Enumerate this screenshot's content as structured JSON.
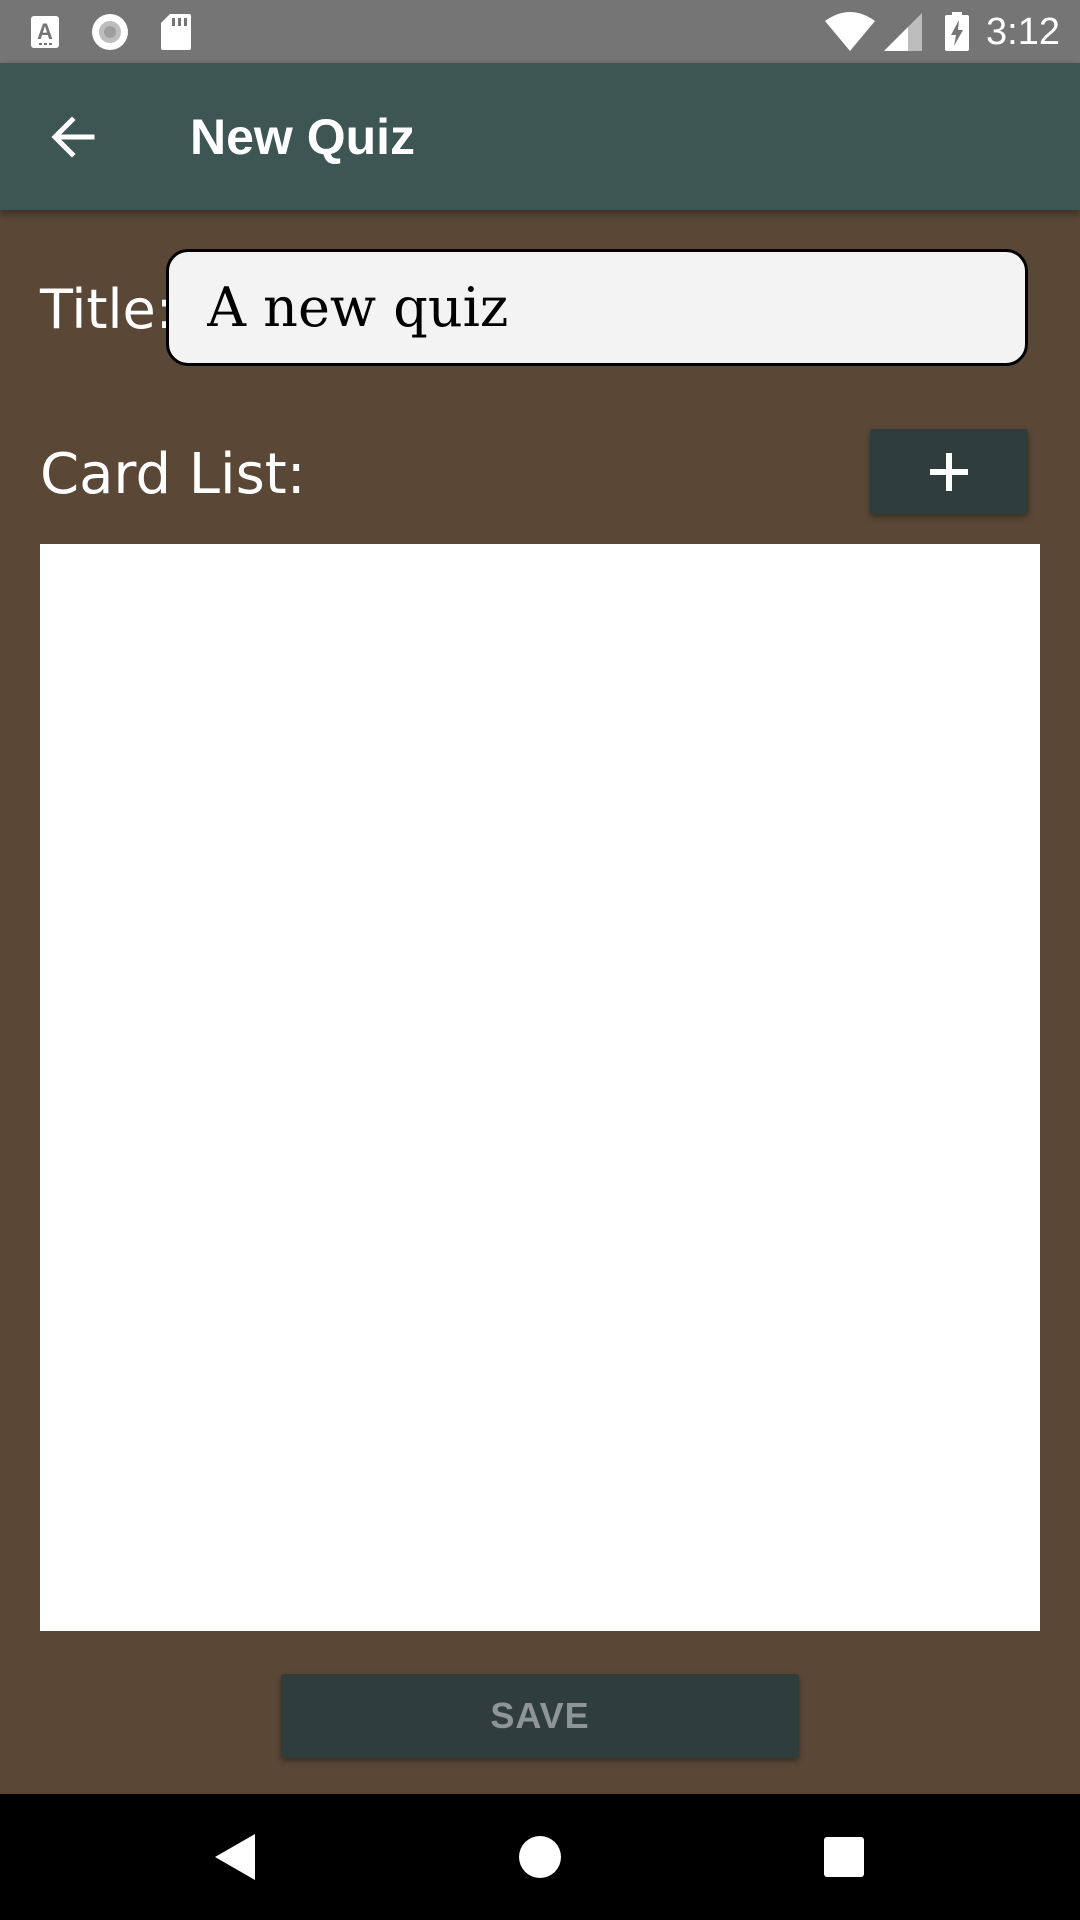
{
  "status_bar": {
    "time": "3:12",
    "icons": [
      "accessibility-a-icon",
      "record-circle-icon",
      "sd-card-icon",
      "wifi-icon",
      "cell-signal-icon",
      "battery-charging-icon"
    ]
  },
  "app_bar": {
    "back_icon": "arrow-back-icon",
    "title": "New Quiz"
  },
  "form": {
    "title_label": "Title:",
    "title_value": "A new quiz"
  },
  "card_list": {
    "label": "Card List:",
    "add_button_label": "+",
    "items": []
  },
  "save_button": {
    "label": "SAVE"
  },
  "nav_bar": {
    "icons": [
      "back-triangle-icon",
      "home-circle-icon",
      "recents-square-icon"
    ]
  },
  "colors": {
    "background": "#5a4736",
    "app_bar": "#3d5553",
    "button": "#2f3e3d",
    "status_bar": "#757575",
    "input_background": "#f3f3f4",
    "save_text_disabled": "#8f9595"
  }
}
